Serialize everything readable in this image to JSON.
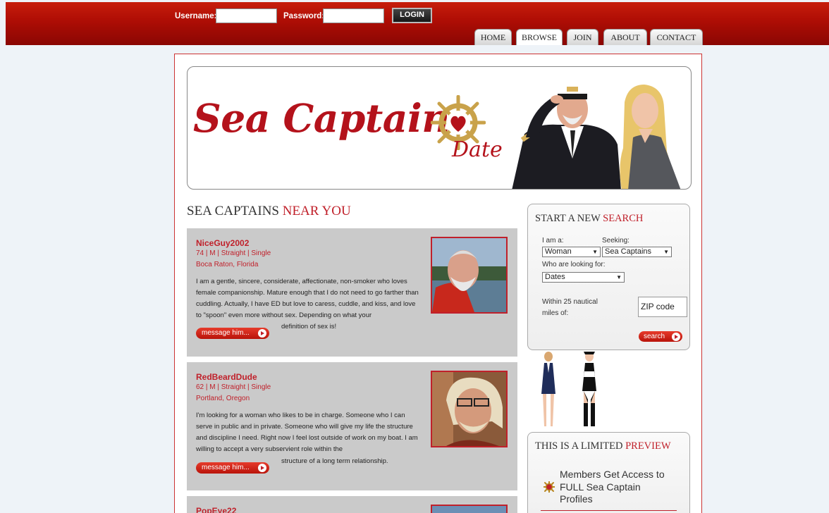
{
  "login": {
    "username_label": "Username:",
    "password_label": "Password:",
    "login_button": "LOGIN"
  },
  "nav": {
    "tabs": [
      {
        "label": "HOME"
      },
      {
        "label": "BROWSE",
        "active": true
      },
      {
        "label": "JOIN"
      },
      {
        "label": "ABOUT"
      },
      {
        "label": "CONTACT"
      }
    ]
  },
  "banner": {
    "logo_main": "Sea Captain",
    "logo_sub": "Date"
  },
  "section": {
    "title_dark": "SEA CAPTAINS",
    "title_red": "NEAR YOU"
  },
  "profiles": [
    {
      "name": "NiceGuy2002",
      "meta": "74 | M | Straight | Single",
      "location": "Boca Raton, Florida",
      "bio": "I am a gentle, sincere, considerate, affectionate, non-smoker who loves female companionship. Mature enough that I do not need to go farther than cuddling. Actually, I have ED but love to caress, cuddle, and kiss, and love to \"spoon\" even more without sex. Depending on what your",
      "bio_end": "definition of sex is!",
      "message_label": "message him..."
    },
    {
      "name": "RedBeardDude",
      "meta": "62 | M | Straight | Single",
      "location": "Portland, Oregon",
      "bio": "I'm looking for a woman who likes to be in charge. Someone who I can serve in public and in private. Someone who will give my life the structure and discipline I need. Right now I feel lost outside of work on my boat. I am willing to accept a very subservient role within the",
      "bio_end": "structure of a long term relationship.",
      "message_label": "message him..."
    },
    {
      "name": "PopEye22"
    }
  ],
  "search": {
    "title_dark": "START A NEW",
    "title_red": "SEARCH",
    "i_am_label": "I am a:",
    "i_am_value": "Woman",
    "seeking_label": "Seeking:",
    "seeking_value": "Sea Captains",
    "looking_for_label": "Who are looking for:",
    "looking_for_value": "Dates",
    "within_label_1": "Within 25 nautical",
    "within_label_2": "miles of:",
    "zip_placeholder": "ZIP code",
    "search_button": "search"
  },
  "preview": {
    "title_dark": "THIS IS A LIMITED",
    "title_red": "PREVIEW",
    "text": "Members Get Access to FULL Sea Captain Profiles"
  },
  "colors": {
    "brand_red": "#c0202a",
    "topbar_red": "#b00e05",
    "card_gray": "#cacaca"
  }
}
